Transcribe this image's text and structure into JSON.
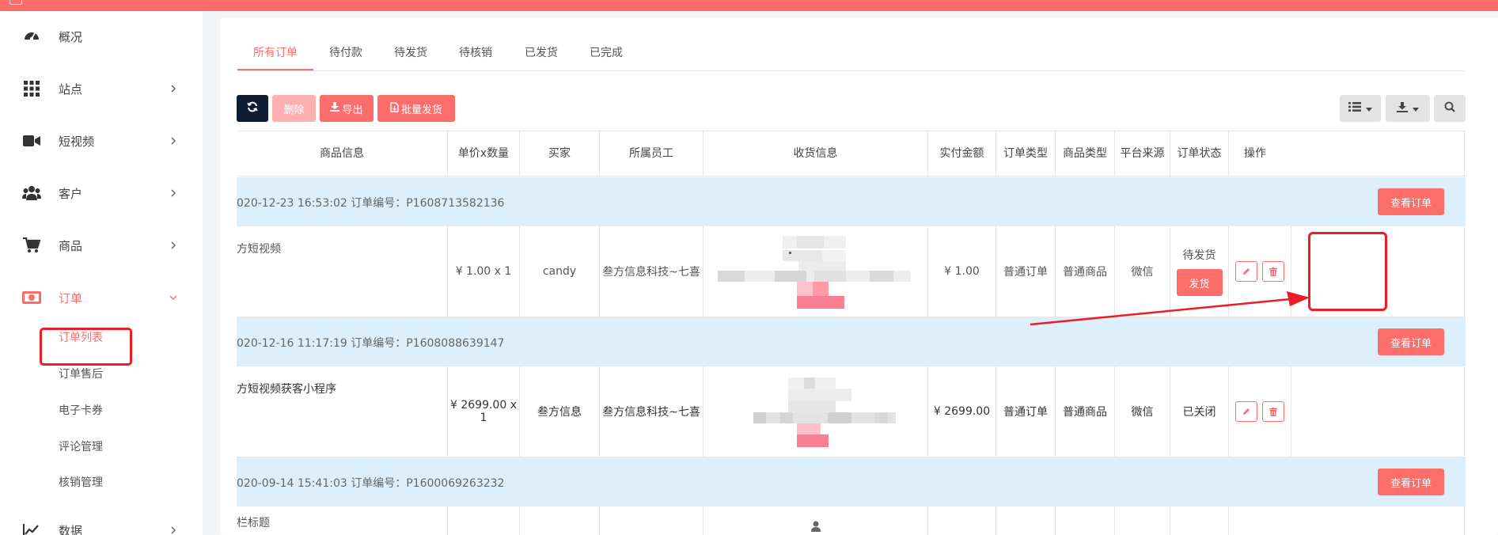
{
  "sidebar": {
    "items": [
      {
        "label": "概况",
        "icon": "dashboard-icon"
      },
      {
        "label": "站点",
        "icon": "grid-icon"
      },
      {
        "label": "短视频",
        "icon": "video-camera-icon"
      },
      {
        "label": "客户",
        "icon": "users-icon"
      },
      {
        "label": "商品",
        "icon": "cart-icon"
      },
      {
        "label": "订单",
        "icon": "money-icon"
      },
      {
        "label": "数据",
        "icon": "chart-line-icon"
      }
    ],
    "sub_items": [
      "订单列表",
      "订单售后",
      "电子卡券",
      "评论管理",
      "核销管理"
    ]
  },
  "tabs": [
    "所有订单",
    "待付款",
    "待发货",
    "待核销",
    "已发货",
    "已完成"
  ],
  "toolbar": {
    "delete_label": "删除",
    "export_label": "导出",
    "batch_ship_label": "批量发货"
  },
  "table": {
    "headers": [
      "商品信息",
      "单价x数量",
      "买家",
      "所属员工",
      "收货信息",
      "实付金额",
      "订单类型",
      "商品类型",
      "平台来源",
      "订单状态",
      "操作"
    ],
    "view_order_label": "查看订单",
    "groups": [
      {
        "header": "020-12-23 16:53:02   订单编号：P1608713582136",
        "product": "方短视频",
        "price_qty": "¥ 1.00 x 1",
        "buyer": "candy",
        "employee": "叁方信息科技~七喜",
        "amount": "¥ 1.00",
        "order_type": "普通订单",
        "goods_type": "普通商品",
        "platform": "微信",
        "status": "待发货",
        "ship_label": "发货"
      },
      {
        "header": "020-12-16 11:17:19   订单编号：P1608088639147",
        "product": "方短视频获客小程序",
        "price_qty": "¥ 2699.00 x 1",
        "buyer": "叁方信息",
        "employee": "叁方信息科技~七喜",
        "amount": "¥ 2699.00",
        "order_type": "普通订单",
        "goods_type": "普通商品",
        "platform": "微信",
        "status": "已关闭"
      },
      {
        "header": "020-09-14 15:41:03   订单编号：P1600069263232",
        "product": "栏标题"
      }
    ]
  },
  "colors": {
    "accent": "#fd6e6a",
    "dark": "#0f1c36",
    "group_bg": "#ddeefc",
    "highlight_red": "#ee1c24"
  }
}
